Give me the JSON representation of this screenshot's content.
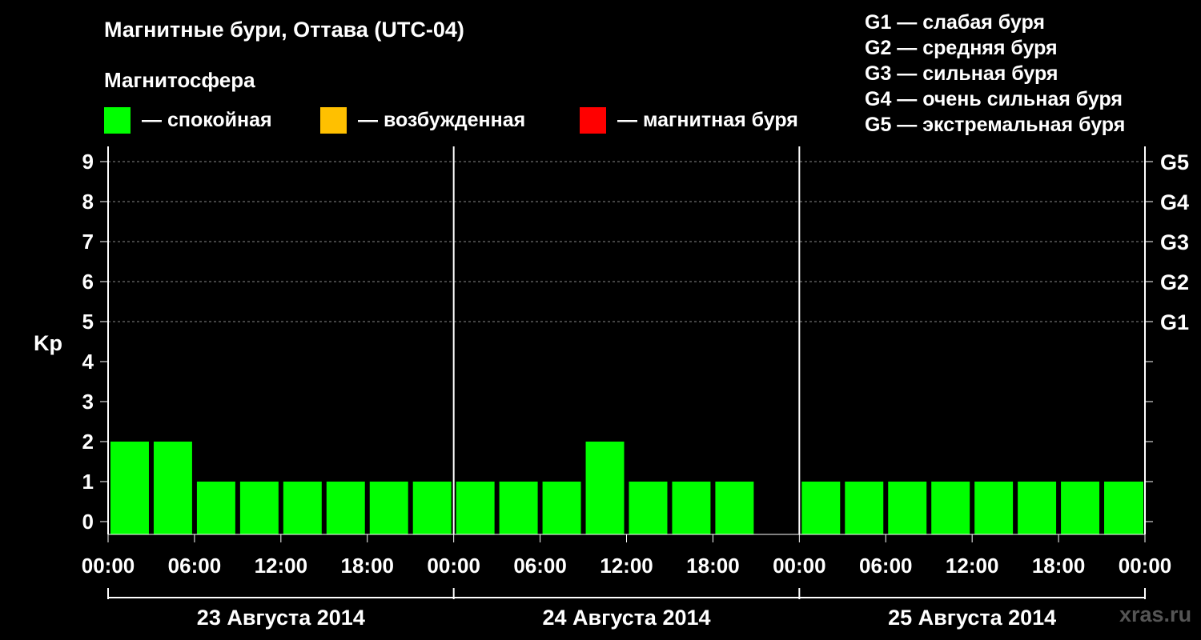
{
  "header": {
    "title": "Магнитные бури, Оттава (UTC-04)",
    "magnetosphere_label": "Магнитосфера"
  },
  "legend": [
    {
      "color": "#00ff00",
      "label": "— спокойная"
    },
    {
      "color": "#ffc000",
      "label": "— возбужденная"
    },
    {
      "color": "#ff0000",
      "label": "— магнитная буря"
    }
  ],
  "g_scale": [
    "G1 — слабая буря",
    "G2 — средняя буря",
    "G3 — сильная буря",
    "G4 — очень сильная буря",
    "G5 — экстремальная буря"
  ],
  "watermark": "xras.ru",
  "chart_data": {
    "type": "bar",
    "ylabel": "Kp",
    "ylim": [
      0,
      9
    ],
    "yticks": [
      "0",
      "1",
      "2",
      "3",
      "4",
      "5",
      "6",
      "7",
      "8",
      "9"
    ],
    "right_axis_labels": [
      {
        "y": 5,
        "label": "G1"
      },
      {
        "y": 6,
        "label": "G2"
      },
      {
        "y": 7,
        "label": "G3"
      },
      {
        "y": 8,
        "label": "G4"
      },
      {
        "y": 9,
        "label": "G5"
      }
    ],
    "x_tick_labels": [
      "00:00",
      "06:00",
      "12:00",
      "18:00",
      "00:00",
      "06:00",
      "12:00",
      "18:00",
      "00:00",
      "06:00",
      "12:00",
      "18:00",
      "00:00"
    ],
    "day_labels": [
      "23 Августа 2014",
      "24 Августа 2014",
      "25 Августа 2014"
    ],
    "interval_hours": 3,
    "total_hours": 72,
    "values": [
      2,
      2,
      1,
      1,
      1,
      1,
      1,
      1,
      1,
      1,
      1,
      2,
      1,
      1,
      1,
      null,
      1,
      1,
      1,
      1,
      1,
      1,
      1,
      1
    ],
    "bar_color": "#00ff00",
    "grid": true,
    "grid_levels": [
      5,
      6,
      7,
      8,
      9
    ]
  }
}
